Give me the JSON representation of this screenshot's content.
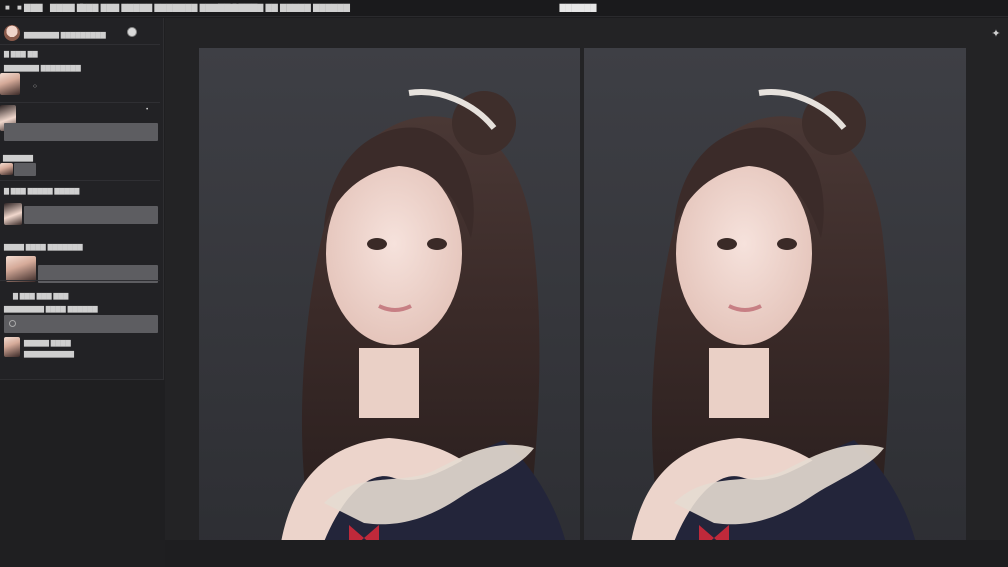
{
  "menubar": {
    "items": [
      "■",
      "■ ▇▇▇",
      "▇▇▇▇ ▇",
      "▇▇▇ ▇▇▇ ▇▇▇▇▇ ▇▇▇▇▇▇▇ ▇▇▇▇▇ ▇▇▇▇",
      "▇▇▇ ▇▇▇▇ ▇▇ ▇▇▇▇▇ ▇▇▇▇▇▇"
    ],
    "title": "▇▇▇▇▇▇"
  },
  "sidebar": {
    "header_label": "▇▇▇▇▇▇▇ ▇▇▇▇▇▇▇▇▇",
    "rows": [
      "▇ ▇▇▇ ▇▇",
      "▇▇▇▇▇▇▇ ▇▇▇▇▇▇▇▇",
      "○",
      "▇▇▇▇▇▇",
      "▇ ▇▇▇ ▇▇▇▇▇ ▇▇▇▇▇",
      "▇▇▇▇ ▇▇▇▇ ▇▇▇▇▇▇▇",
      "▇ ▇▇▇ ▇▇▇ ▇▇▇",
      "▇▇▇▇▇▇▇▇ ▇▇▇▇ ▇▇▇▇▇▇",
      "▇▇▇▇▇ ▇▇▇▇",
      "▇▇▇▇▇▇▇▇▇▇"
    ]
  },
  "colors": {
    "background": "#1c1c1e",
    "field": "#5d5d61",
    "canvas": "#3a3b40",
    "dress": "#23253a",
    "ribbon": "#c0293a"
  },
  "icons": {
    "settings": "settings-dot-icon",
    "tool": "brush-tool-icon"
  }
}
